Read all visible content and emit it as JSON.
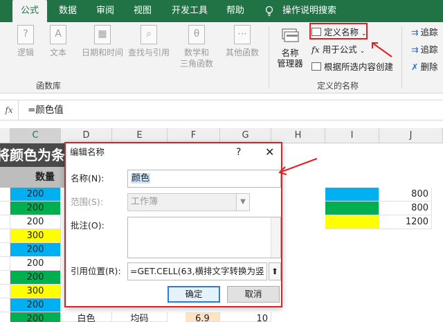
{
  "tabs": [
    {
      "label": "公式",
      "active": true
    },
    {
      "label": "数据"
    },
    {
      "label": "审阅"
    },
    {
      "label": "视图"
    },
    {
      "label": "开发工具"
    },
    {
      "label": "帮助"
    },
    {
      "label": "操作说明搜索"
    }
  ],
  "ribbon": {
    "function_library": {
      "group_label": "函数库",
      "buttons": [
        {
          "label": "逻辑",
          "icon": "logic-icon"
        },
        {
          "label": "文本",
          "icon": "text-icon"
        },
        {
          "label": "日期和时间",
          "icon": "datetime-icon"
        },
        {
          "label": "查找与引用",
          "icon": "lookup-icon"
        },
        {
          "label": "数学和",
          "label2": "三角函数",
          "icon": "math-icon"
        },
        {
          "label": "其他函数",
          "icon": "more-functions-icon"
        }
      ]
    },
    "defined_names": {
      "group_label": "定义的名称",
      "name_manager": "名称",
      "name_manager2": "管理器",
      "define_name": "定义名称",
      "use_in_formula": "用于公式",
      "create_from_selection": "根据所选内容创建"
    },
    "auditing": {
      "trace_precedents": "追踪",
      "trace_dependents": "追踪",
      "remove_arrows": "删除"
    }
  },
  "formula_bar": {
    "fx": "fx",
    "value": "=颜色值"
  },
  "columns": [
    "C",
    "D",
    "E",
    "F",
    "G",
    "H",
    "I",
    "J"
  ],
  "sheet": {
    "banner": "将颜色为条",
    "qty_header": "数量",
    "c_values": [
      "200",
      "200",
      "200",
      "300",
      "200",
      "200",
      "200",
      "300",
      "200",
      "200"
    ],
    "j_values": [
      "800",
      "800",
      "1200"
    ],
    "bottom_d": "白色",
    "bottom_e": "均码",
    "bottom_f": "6.9",
    "bottom_g": "10"
  },
  "colors": {
    "blue": "#00b0f0",
    "green": "#00b050",
    "yellow": "#ffff00",
    "accent": "#217346",
    "highlight": "#e02020"
  },
  "dialog": {
    "title": "编辑名称",
    "help": "?",
    "close": "✕",
    "name_label": "名称(N):",
    "name_value": "颜色",
    "scope_label": "范围(S):",
    "scope_value": "工作簿",
    "comment_label": "批注(O):",
    "comment_value": "",
    "ref_label": "引用位置(R):",
    "ref_value": "=GET.CELL(63,横排文字转换为竖",
    "ok": "确定",
    "cancel": "取消"
  }
}
